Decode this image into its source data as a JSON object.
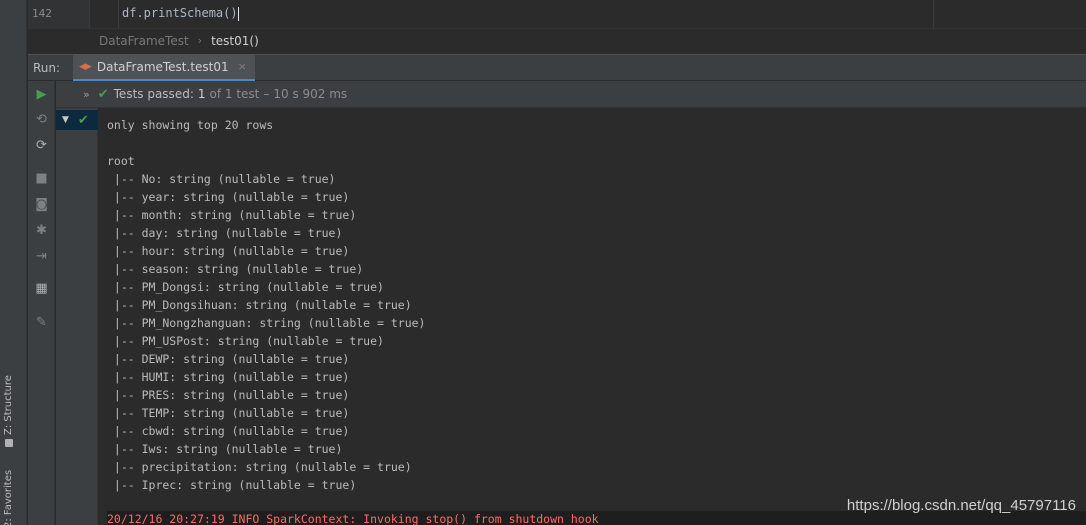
{
  "editor": {
    "line_number": "142",
    "code": "df.printSchema()"
  },
  "breadcrumb": {
    "class_name": "DataFrameTest",
    "separator": "›",
    "method_name": "test01()"
  },
  "run_panel": {
    "label": "Run:",
    "tab_label": "DataFrameTest.test01",
    "tab_close": "×"
  },
  "status": {
    "chevron": "»",
    "passed_label": "Tests passed:",
    "passed_count": "1",
    "of_total": "of 1 test",
    "separator": "–",
    "duration": "10 s 902 ms"
  },
  "console": {
    "lines": [
      "only showing top 20 rows",
      "",
      "root",
      " |-- No: string (nullable = true)",
      " |-- year: string (nullable = true)",
      " |-- month: string (nullable = true)",
      " |-- day: string (nullable = true)",
      " |-- hour: string (nullable = true)",
      " |-- season: string (nullable = true)",
      " |-- PM_Dongsi: string (nullable = true)",
      " |-- PM_Dongsihuan: string (nullable = true)",
      " |-- PM_Nongzhanguan: string (nullable = true)",
      " |-- PM_USPost: string (nullable = true)",
      " |-- DEWP: string (nullable = true)",
      " |-- HUMI: string (nullable = true)",
      " |-- PRES: string (nullable = true)",
      " |-- TEMP: string (nullable = true)",
      " |-- cbwd: string (nullable = true)",
      " |-- Iws: string (nullable = true)",
      " |-- precipitation: string (nullable = true)",
      " |-- Iprec: string (nullable = true)",
      ""
    ],
    "error_line": "20/12/16 20:27:19 INFO SparkContext: Invoking stop() from shutdown hook"
  },
  "side_panels": {
    "structure": "Z: Structure",
    "favorites": "2: Favorites"
  },
  "watermark": "https://blog.csdn.net/qq_45797116",
  "colors": {
    "background": "#2b2b2b",
    "panel": "#3c3f41",
    "passed_green": "#499c54",
    "error_red": "#ff6b68",
    "selection": "#0d293e"
  },
  "icons": {
    "run": "play-icon",
    "rerun_failed": "rerun-failed-icon",
    "toggle_auto_test": "auto-test-icon",
    "stop": "stop-icon",
    "snapshot": "camera-icon",
    "debug": "bug-icon",
    "exit": "exit-icon",
    "layout": "layout-icon",
    "pin": "pin-icon"
  }
}
